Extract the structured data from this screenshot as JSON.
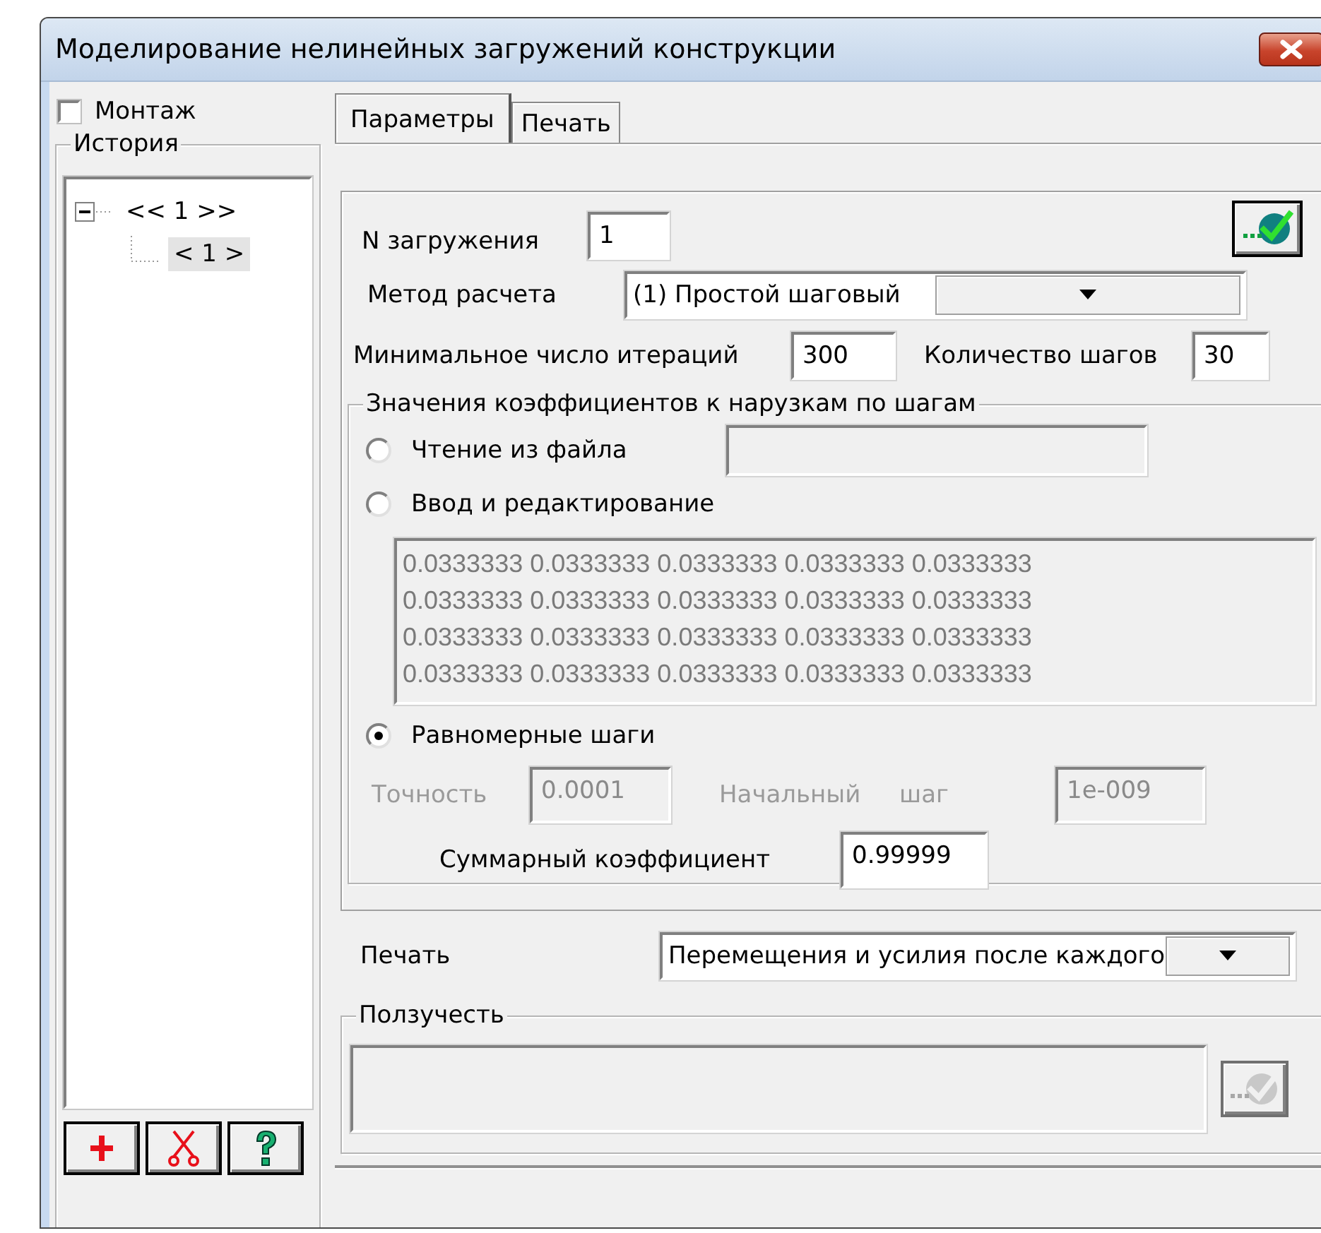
{
  "window": {
    "title": "Моделирование нелинейных загружений конструкции"
  },
  "montage": {
    "label": "Монтаж",
    "checked": false
  },
  "history": {
    "title": "История",
    "tree": [
      {
        "label": "<< 1 >>",
        "expanded": true,
        "selected": false,
        "children": [
          {
            "label": "< 1 >",
            "selected": true
          }
        ]
      }
    ]
  },
  "history_buttons": [
    {
      "kind": "add"
    },
    {
      "kind": "cut"
    },
    {
      "kind": "help"
    }
  ],
  "tabs": [
    {
      "label": "Параметры",
      "selected": true
    },
    {
      "label": "Печать",
      "selected": false
    }
  ],
  "load_number": {
    "label": "N загружения",
    "value": "1"
  },
  "method": {
    "label": "Метод расчета",
    "value": "(1) Простой шаговый"
  },
  "min_iterations": {
    "label": "Минимальное число итераций",
    "value": "300"
  },
  "step_count": {
    "label": "Количество шагов",
    "value": "30"
  },
  "coefficients": {
    "title": "Значения коэффициентов к нарузкам по шагам",
    "options": [
      {
        "kind": "file",
        "label": "Чтение из файла",
        "selected": false
      },
      {
        "kind": "edit",
        "label": "Ввод и редактирование",
        "selected": false
      },
      {
        "kind": "uniform",
        "label": "Равномерные шаги",
        "selected": true
      }
    ],
    "file_field": {
      "disabled": true
    },
    "values": {
      "disabled": true,
      "lines": [
        "0.0333333 0.0333333 0.0333333 0.0333333 0.0333333",
        "0.0333333 0.0333333 0.0333333 0.0333333 0.0333333",
        "0.0333333 0.0333333 0.0333333 0.0333333 0.0333333",
        "0.0333333 0.0333333 0.0333333 0.0333333 0.0333333"
      ]
    },
    "accuracy": {
      "label": "Точность",
      "value": "0.0001",
      "disabled": true
    },
    "initial_step": {
      "label": "Начальный шаг",
      "value": "1e-009",
      "disabled": true
    },
    "total": {
      "label": "Суммарный коэффициент",
      "value": "0.99999"
    }
  },
  "print": {
    "label": "Печать",
    "value": "Перемещения и усилия после каждого"
  },
  "creep": {
    "title": "Ползучесть",
    "field": {
      "disabled": true
    },
    "button": {
      "disabled": true
    }
  }
}
